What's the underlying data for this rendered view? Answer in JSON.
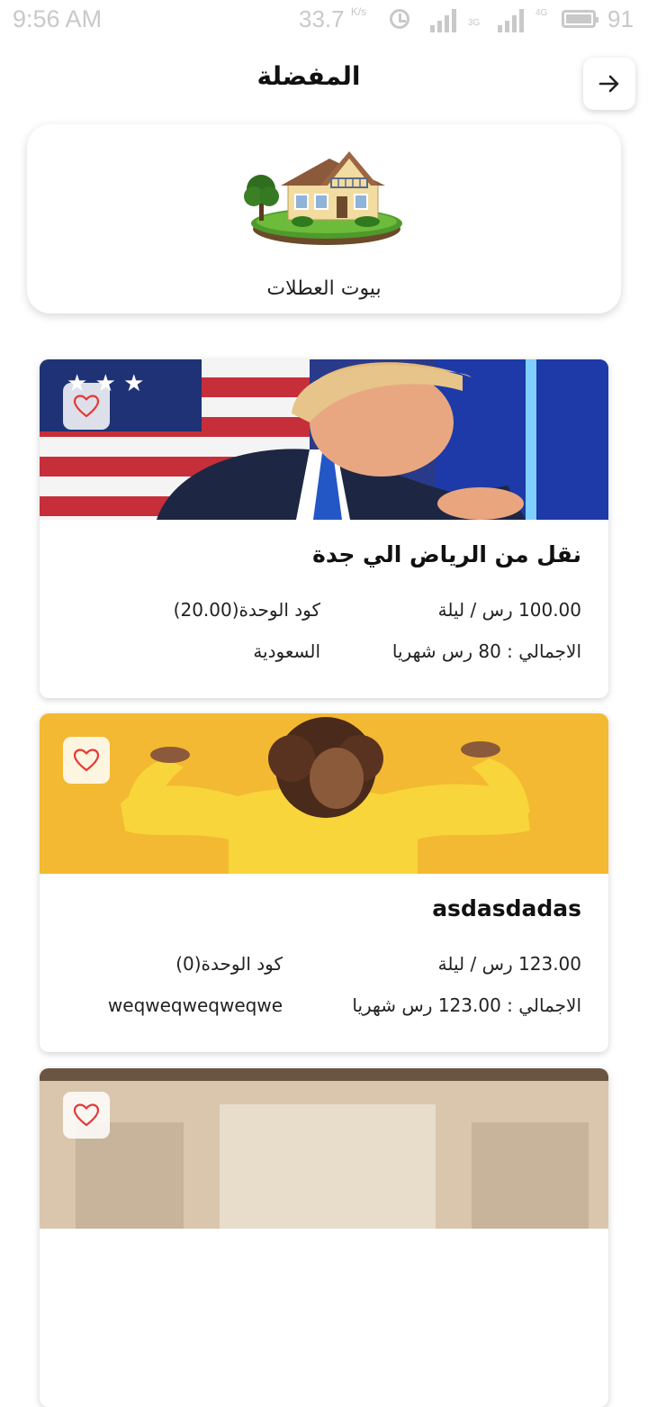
{
  "status_bar": {
    "time": "9:56 AM",
    "net_speed": "33.7",
    "net_speed_unit": "K/s",
    "net_3g": "3G",
    "net_4g": "4G",
    "battery": "91"
  },
  "header": {
    "title": "المفضلة",
    "back_icon": "arrow-right-icon"
  },
  "category": {
    "label": "بيوت العطلات",
    "icon": "vacation-house-image"
  },
  "listings": [
    {
      "title": "نقل من الرياض الي جدة",
      "price": "100.00 رس / ليلة",
      "unit_code": "كود الوحدة(20.00)",
      "total": "الاجمالي : 80 رس شهريا",
      "location": "السعودية",
      "favorite_icon": "heart-outline-icon"
    },
    {
      "title": "asdasdadas",
      "price": "123.00 رس / ليلة",
      "unit_code": "كود الوحدة(0)",
      "total": "الاجمالي : 123.00 رس شهريا",
      "location": "weqweqweqweqwe",
      "favorite_icon": "heart-outline-icon"
    },
    {
      "favorite_icon": "heart-outline-icon"
    }
  ],
  "colors": {
    "heart": "#e53935",
    "card_bg": "#ffffff",
    "status_text": "#c9c9c9"
  }
}
